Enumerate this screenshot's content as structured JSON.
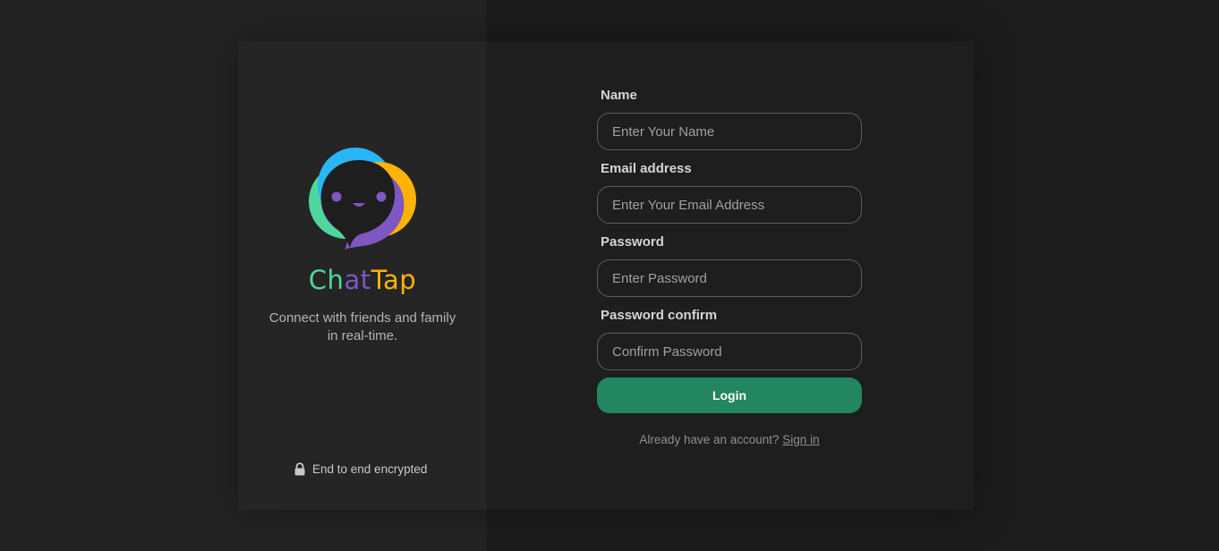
{
  "brand": {
    "name_part1": "Ch",
    "name_part2": "at",
    "name_part3": "Tap",
    "tagline": "Connect with friends and family in real-time.",
    "logo_icon": "chat-bubble-smiley-logo",
    "colors": {
      "green": "#4fd69c",
      "purple": "#7e57c2",
      "yellow": "#ffb300",
      "blue": "#29b6f6"
    }
  },
  "security": {
    "icon": "lock-icon",
    "text": "End to end encrypted"
  },
  "form": {
    "name": {
      "label": "Name",
      "placeholder": "Enter Your Name",
      "value": ""
    },
    "email": {
      "label": "Email address",
      "placeholder": "Enter Your Email Address",
      "value": ""
    },
    "password": {
      "label": "Password",
      "placeholder": "Enter Password",
      "value": ""
    },
    "password_confirm": {
      "label": "Password confirm",
      "placeholder": "Confirm Password",
      "value": ""
    },
    "submit_label": "Login",
    "submit_color": "#228660"
  },
  "signin": {
    "prompt": "Already have an account?",
    "link_label": "Sign in"
  }
}
